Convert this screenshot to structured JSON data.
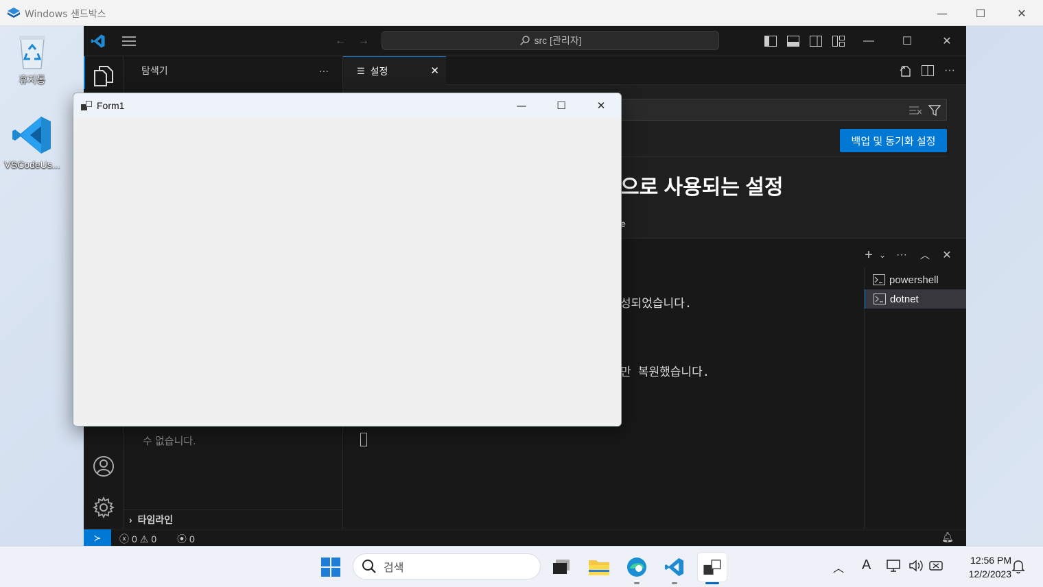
{
  "sandbox": {
    "title": "Windows 샌드박스",
    "controls": {
      "minimize": "—",
      "maximize": "☐",
      "close": "✕"
    }
  },
  "desktop": {
    "icons": [
      {
        "label": "휴지통",
        "icon": "recycle-bin-icon"
      },
      {
        "label": "VSCodeUs...",
        "icon": "vscode-icon"
      }
    ]
  },
  "vscode": {
    "command_center": "src [관리자]",
    "sidebar": {
      "title": "탐색기",
      "more": "···",
      "hidden_text_line2": "수 없습니다.",
      "timeline_label": "타임라인"
    },
    "tab": {
      "label": "설정",
      "close": "✕"
    },
    "settings": {
      "sync_button": "백업 및 동기화 설정",
      "heading_fragment": "으로 사용되는 설정",
      "scope_fragment": "e"
    },
    "terminal": {
      "lines": [
        "성되었습니다.",
        "만 복원했습니다."
      ],
      "sessions": [
        {
          "name": "powershell",
          "selected": false
        },
        {
          "name": "dotnet",
          "selected": true
        }
      ]
    },
    "status": {
      "errors": "0",
      "warnings": "0",
      "ports": "0"
    }
  },
  "form1": {
    "title": "Form1"
  },
  "taskbar": {
    "search_placeholder": "검색",
    "clock_time": "12:56 PM",
    "clock_date": "12/2/2023",
    "ime": "A"
  },
  "colors": {
    "accent": "#0078d4",
    "vscode_bg": "#1f1f1f",
    "vscode_panel": "#181818",
    "form_bg": "#f0f0f0"
  }
}
